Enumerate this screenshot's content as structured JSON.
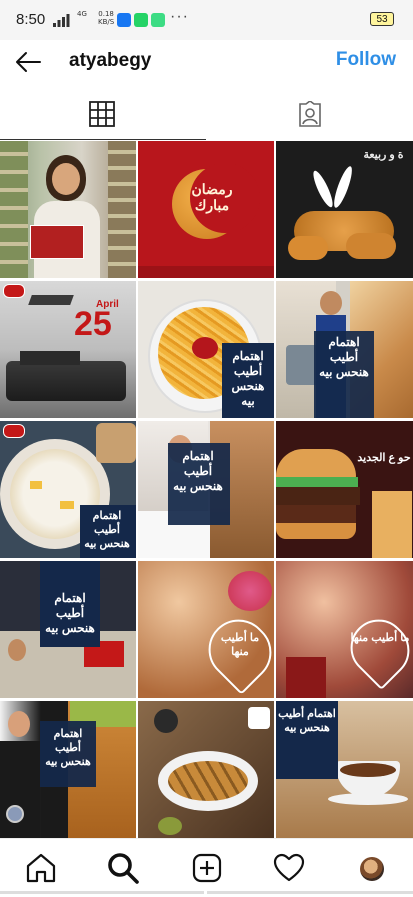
{
  "status_bar": {
    "time": "8:50",
    "network": "4G",
    "speed_value": "0.18",
    "speed_unit": "KB/S",
    "more": "···",
    "battery": "53"
  },
  "header": {
    "username": "atyabegy",
    "follow_label": "Follow"
  },
  "tabs": [
    {
      "icon": "grid-icon"
    },
    {
      "icon": "tagged-icon"
    }
  ],
  "grid": {
    "posts": [
      {
        "kind": "woman-holding-box",
        "text": ""
      },
      {
        "kind": "ramadan-crescent",
        "text": "رمضان مبارك"
      },
      {
        "kind": "easter-nuggets",
        "text": "ة و ربيعة"
      },
      {
        "kind": "april-25",
        "month": "April",
        "day": "25"
      },
      {
        "kind": "fries",
        "text": "اهتمام أطيب هنحس بيه"
      },
      {
        "kind": "man-car-chicken",
        "text": "اهتمام أطيب هنحس بيه"
      },
      {
        "kind": "soup",
        "text": "اهتمام أطيب هنحس بيه"
      },
      {
        "kind": "woman-bed",
        "text": "اهتمام أطيب هنحس بيه"
      },
      {
        "kind": "burger",
        "text": "حو ع الجديد"
      },
      {
        "kind": "family-table",
        "text": "اهتمام أطيب هنحس بيه"
      },
      {
        "kind": "mother-child-heart",
        "text": "ما أطيب منها"
      },
      {
        "kind": "couple-dance-heart",
        "text": "ما أطيب منها"
      },
      {
        "kind": "suit-chicken",
        "text": "اهتمام أطيب هنحس بيه"
      },
      {
        "kind": "grill-platter",
        "text": ""
      },
      {
        "kind": "coffee-cup",
        "text": "اهتمام أطيب هنحس بيه"
      }
    ]
  },
  "bottom_nav": [
    {
      "icon": "home-icon"
    },
    {
      "icon": "search-icon"
    },
    {
      "icon": "add-post-icon"
    },
    {
      "icon": "heart-icon"
    },
    {
      "icon": "profile-avatar"
    }
  ],
  "colors": {
    "accent": "#2f8fe6",
    "brand_red": "#c41818"
  }
}
